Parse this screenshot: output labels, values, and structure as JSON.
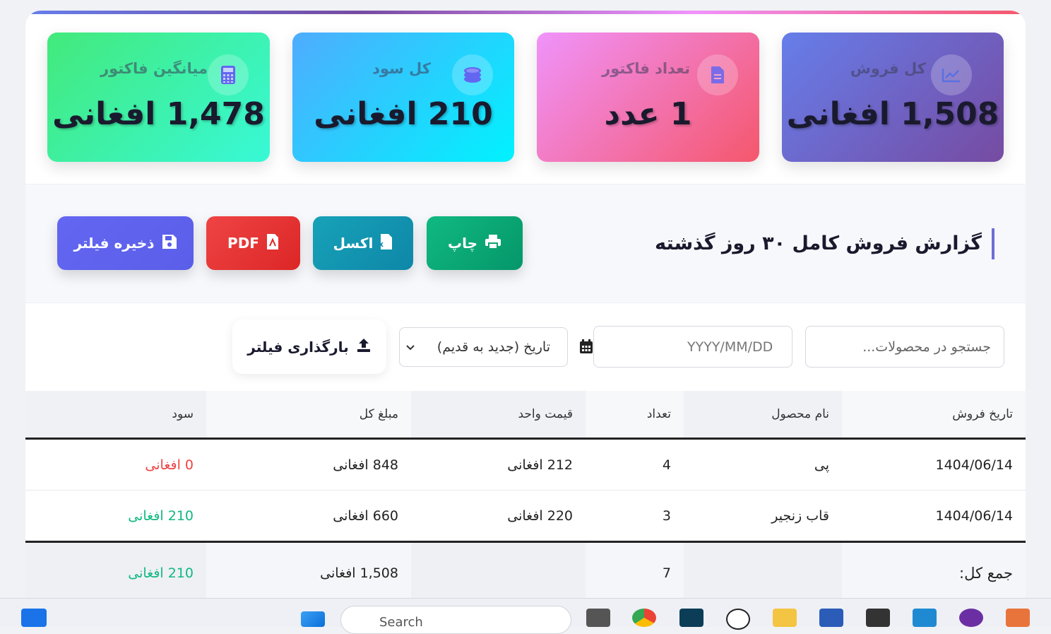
{
  "stats": {
    "sales": {
      "title": "کل فروش",
      "value": "1,508 افغانی",
      "icon": "chart-line-icon"
    },
    "invoices": {
      "title": "تعداد فاکتور",
      "value": "1 عدد",
      "icon": "file-invoice-icon"
    },
    "profit": {
      "title": "کل سود",
      "value": "210 افغانی",
      "icon": "coins-icon"
    },
    "avg": {
      "title": "میانگین فاکتور",
      "value": "1,478 افغانی",
      "icon": "calculator-icon"
    }
  },
  "report": {
    "title": "گزارش فروش کامل ۳۰ روز گذشته",
    "print": "چاپ",
    "excel": "اکسل",
    "pdf": "PDF",
    "save_filter": "ذخیره فیلتر"
  },
  "filters": {
    "search_placeholder": "جستجو در محصولات...",
    "date_placeholder": "YYYY/MM/DD",
    "sort_selected": "تاریخ (جدید به قدیم)",
    "load_filter": "بارگذاری فیلتر"
  },
  "table": {
    "headers": [
      "تاریخ فروش",
      "نام محصول",
      "تعداد",
      "قیمت واحد",
      "مبلغ کل",
      "سود"
    ],
    "rows": [
      [
        "1404/06/14",
        "پی",
        "4",
        "212 افغانی",
        "848 افغانی",
        "0 افغانی"
      ],
      [
        "1404/06/14",
        "قاب زنجیر",
        "3",
        "220 افغانی",
        "660 افغانی",
        "210 افغانی"
      ]
    ],
    "footer": {
      "label": "جمع کل:",
      "qty": "7",
      "total": "1,508 افغانی",
      "profit": "210 افغانی"
    }
  },
  "taskbar": {
    "search": "Search"
  }
}
